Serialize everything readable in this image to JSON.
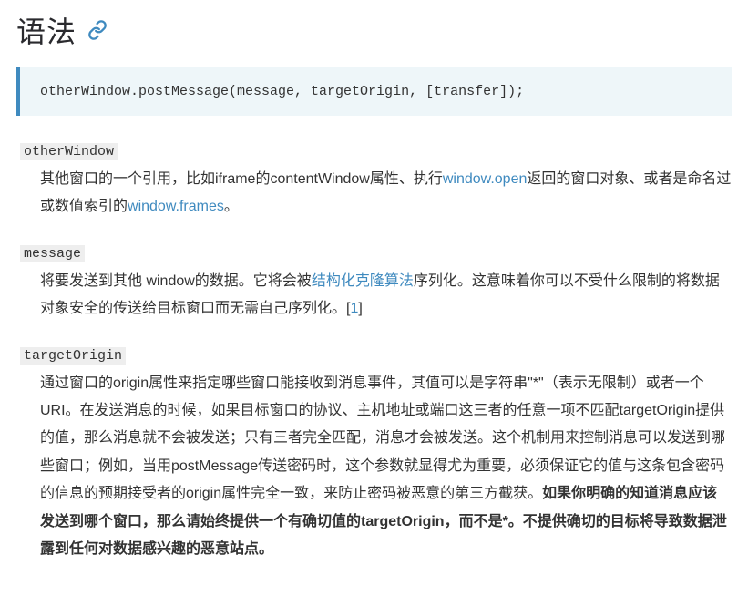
{
  "heading": {
    "title": "语法"
  },
  "code": {
    "content": "otherWindow.postMessage(message, targetOrigin, [transfer]);"
  },
  "definitions": [
    {
      "term": "otherWindow",
      "segments": [
        {
          "t": "其他窗口的一个引用，比如iframe的contentWindow属性、执行"
        },
        {
          "t": "window.open",
          "link": true
        },
        {
          "t": "返回的窗口对象、或者是命名过或数值索引的"
        },
        {
          "t": "window.frames",
          "link": true
        },
        {
          "t": "。"
        }
      ]
    },
    {
      "term": "message",
      "segments": [
        {
          "t": "将要发送到其他 window的数据。它将会被"
        },
        {
          "t": "结构化克隆算法",
          "link": true
        },
        {
          "t": "序列化。这意味着你可以不受什么限制的将数据对象安全的传送给目标窗口而无需自己序列化。["
        },
        {
          "t": "1",
          "link": true
        },
        {
          "t": "]"
        }
      ]
    },
    {
      "term": "targetOrigin",
      "segments": [
        {
          "t": "通过窗口的origin属性来指定哪些窗口能接收到消息事件，其值可以是字符串\"*\"（表示无限制）或者一个URI。在发送消息的时候，如果目标窗口的协议、主机地址或端口这三者的任意一项不匹配targetOrigin提供的值，那么消息就不会被发送；只有三者完全匹配，消息才会被发送。这个机制用来控制消息可以发送到哪些窗口；例如，当用postMessage传送密码时，这个参数就显得尤为重要，必须保证它的值与这条包含密码的信息的预期接受者的origin属性完全一致，来防止密码被恶意的第三方截获。"
        },
        {
          "t": "如果你明确的知道消息应该发送到哪个窗口，那么请始终提供一个有确切值的targetOrigin，而不是*。不提供确切的目标将导致数据泄露到任何对数据感兴趣的恶意站点。",
          "bold": true
        }
      ]
    }
  ]
}
